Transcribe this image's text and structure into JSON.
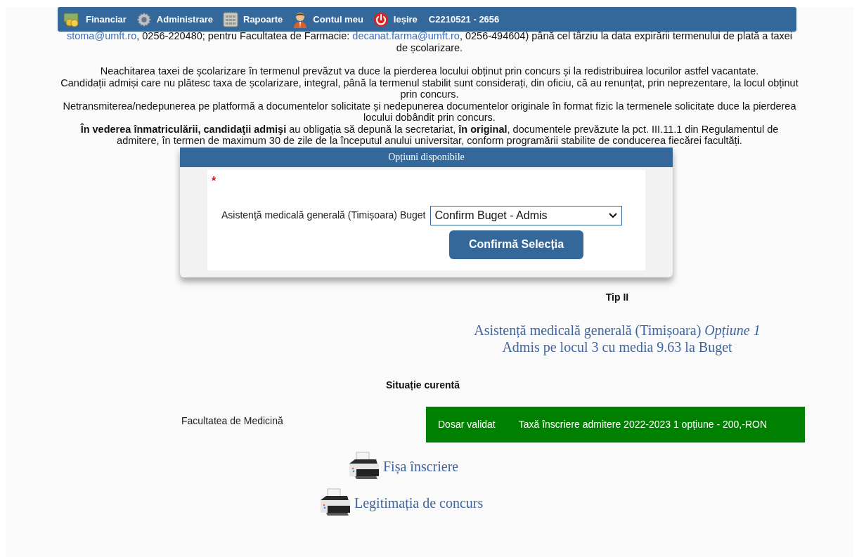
{
  "nav": {
    "items": [
      {
        "label": "Financiar",
        "kind": "money"
      },
      {
        "label": "Administrare",
        "kind": "gear"
      },
      {
        "label": "Rapoarte",
        "kind": "calculator"
      },
      {
        "label": "Contul meu",
        "kind": "user"
      },
      {
        "label": "Ieșire",
        "kind": "power"
      }
    ],
    "user_code": "C2210521 - 2656"
  },
  "intro": [
    {
      "kind": "link",
      "text": "stoma@umft.ro"
    },
    {
      "kind": "text",
      "text": ", 0256-220480; pentru Facultatea de Farmacie: "
    },
    {
      "kind": "link",
      "text": "decanat.farma@umft.ro"
    },
    {
      "kind": "text",
      "text": ", 0256-494604) până cel târziu la data expirării termenului de plată a taxei de școlarizare."
    }
  ],
  "paragraphs": [
    "Neachitarea taxei de școlarizare în termenul prevăzut va duce la pierderea locului obținut prin concurs și la redistribuirea locurilor astfel vacantate.",
    "Candidații admiși care nu plătesc taxa de școlarizare, integral, până la termenul stabilit sunt considerați, din oficiu, că au renunțat, prin neprezentare, la locul obținut prin concurs.",
    "Netransmiterea/nedepunerea pe platformă a documentelor solicitate și nedepunerea documentelor originale în format fizic la termenele solicitate duce la pierderea locului dobândit prin concurs.",
    "**În vederea înmatriculării, candidaţii admişi** au obligația să depună la secretariat, **în original**, documentele prevăzute la pct. III.11.1 din Regulamentul de admitere, în termen de maximum 30 de zile de la începutul anului universitar, conform programării stabilite de conducerea fiecărei facultăți."
  ],
  "options_panel": {
    "title": "Opțiuni disponibile",
    "required_mark": "*",
    "label": "Asistenţă medicală generală (Timișoara) Buget",
    "select_value": "Confirm Buget - Admis",
    "button": "Confirmă Selecția"
  },
  "tip": "Tip II",
  "result": {
    "line_1": "Asistență medicală generală (Timișoara) *Opțiune 1*",
    "line_2": "Admis pe locul 3 cu media 9.63 la Buget"
  },
  "status": {
    "heading": "Situație curentă",
    "faculty": "Facultatea de Medicină",
    "badges": [
      "Dosar validat",
      "Taxă înscriere admitere 2022-2023 1 opțiune - 200,-RON"
    ]
  },
  "print_links": [
    "Fișa înscriere",
    "Legitimația de concurs"
  ]
}
